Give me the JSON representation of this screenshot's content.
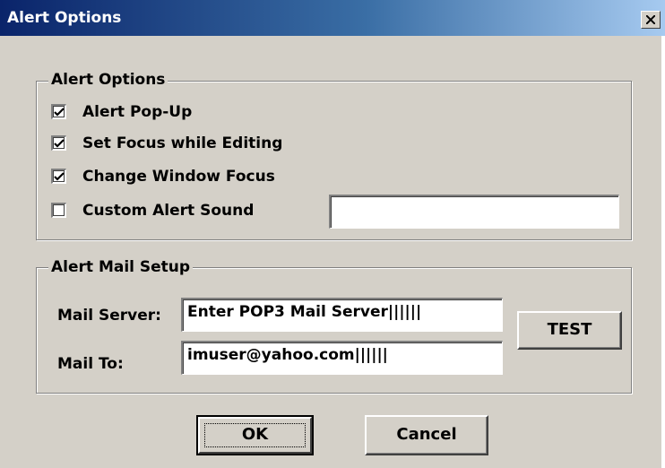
{
  "window": {
    "title": "Alert Options",
    "close_icon": "close-icon"
  },
  "alert_options": {
    "legend": "Alert Options",
    "items": [
      {
        "label": "Alert Pop-Up",
        "checked": true
      },
      {
        "label": "Set Focus while Editing",
        "checked": true
      },
      {
        "label": "Change Window Focus",
        "checked": true
      },
      {
        "label": "Custom Alert Sound",
        "checked": false
      }
    ],
    "sound_field_value": ""
  },
  "mail_setup": {
    "legend": "Alert Mail Setup",
    "server_label": "Mail Server:",
    "server_value": "Enter POP3 Mail Server",
    "to_label": "Mail To:",
    "to_value": "imuser@yahoo.com",
    "trailing_marks": "||||||",
    "test_label": "TEST"
  },
  "buttons": {
    "ok_label": "OK",
    "cancel_label": "Cancel"
  }
}
